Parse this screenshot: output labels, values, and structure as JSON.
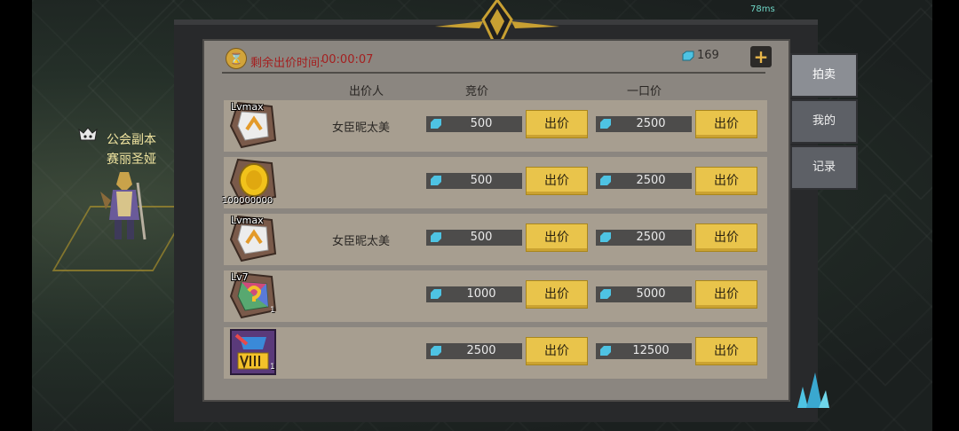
{
  "timer": {
    "label": "剩余出价时间:",
    "value": "00:00:07"
  },
  "currency": {
    "count": "169",
    "plus": "+"
  },
  "columns": {
    "bidder": "出价人",
    "bid": "竞价",
    "buyout": "一口价"
  },
  "bid_button_label": "出价",
  "rows": [
    {
      "level": "Lvmax",
      "count": "",
      "icon": "rune-lvmax-icon",
      "bidder": "女臣昵太美",
      "bid": "500",
      "buyout": "2500"
    },
    {
      "level": "",
      "count": "100000000",
      "icon": "gold-coin-icon",
      "bidder": "",
      "bid": "500",
      "buyout": "2500"
    },
    {
      "level": "Lvmax",
      "count": "",
      "icon": "rune-lvmax-icon",
      "bidder": "女臣昵太美",
      "bid": "500",
      "buyout": "2500"
    },
    {
      "level": "Lv7",
      "count": "1",
      "icon": "rainbow-rune-icon",
      "bidder": "",
      "bid": "1000",
      "buyout": "5000"
    },
    {
      "level": "",
      "count": "1",
      "icon": "tier-viii-chest-icon",
      "bidder": "",
      "bid": "2500",
      "buyout": "12500"
    }
  ],
  "tabs": [
    "拍卖",
    "我的",
    "记录"
  ],
  "guild": {
    "name": "公会副本",
    "player": "赛丽圣娅"
  },
  "status": {
    "wifi": "78ms"
  },
  "colors": {
    "button": "#e9c44b",
    "timer_text": "#a41f1f",
    "panel": "#8b8680",
    "row": "#a79e90",
    "gem": "#4ec3e3"
  }
}
